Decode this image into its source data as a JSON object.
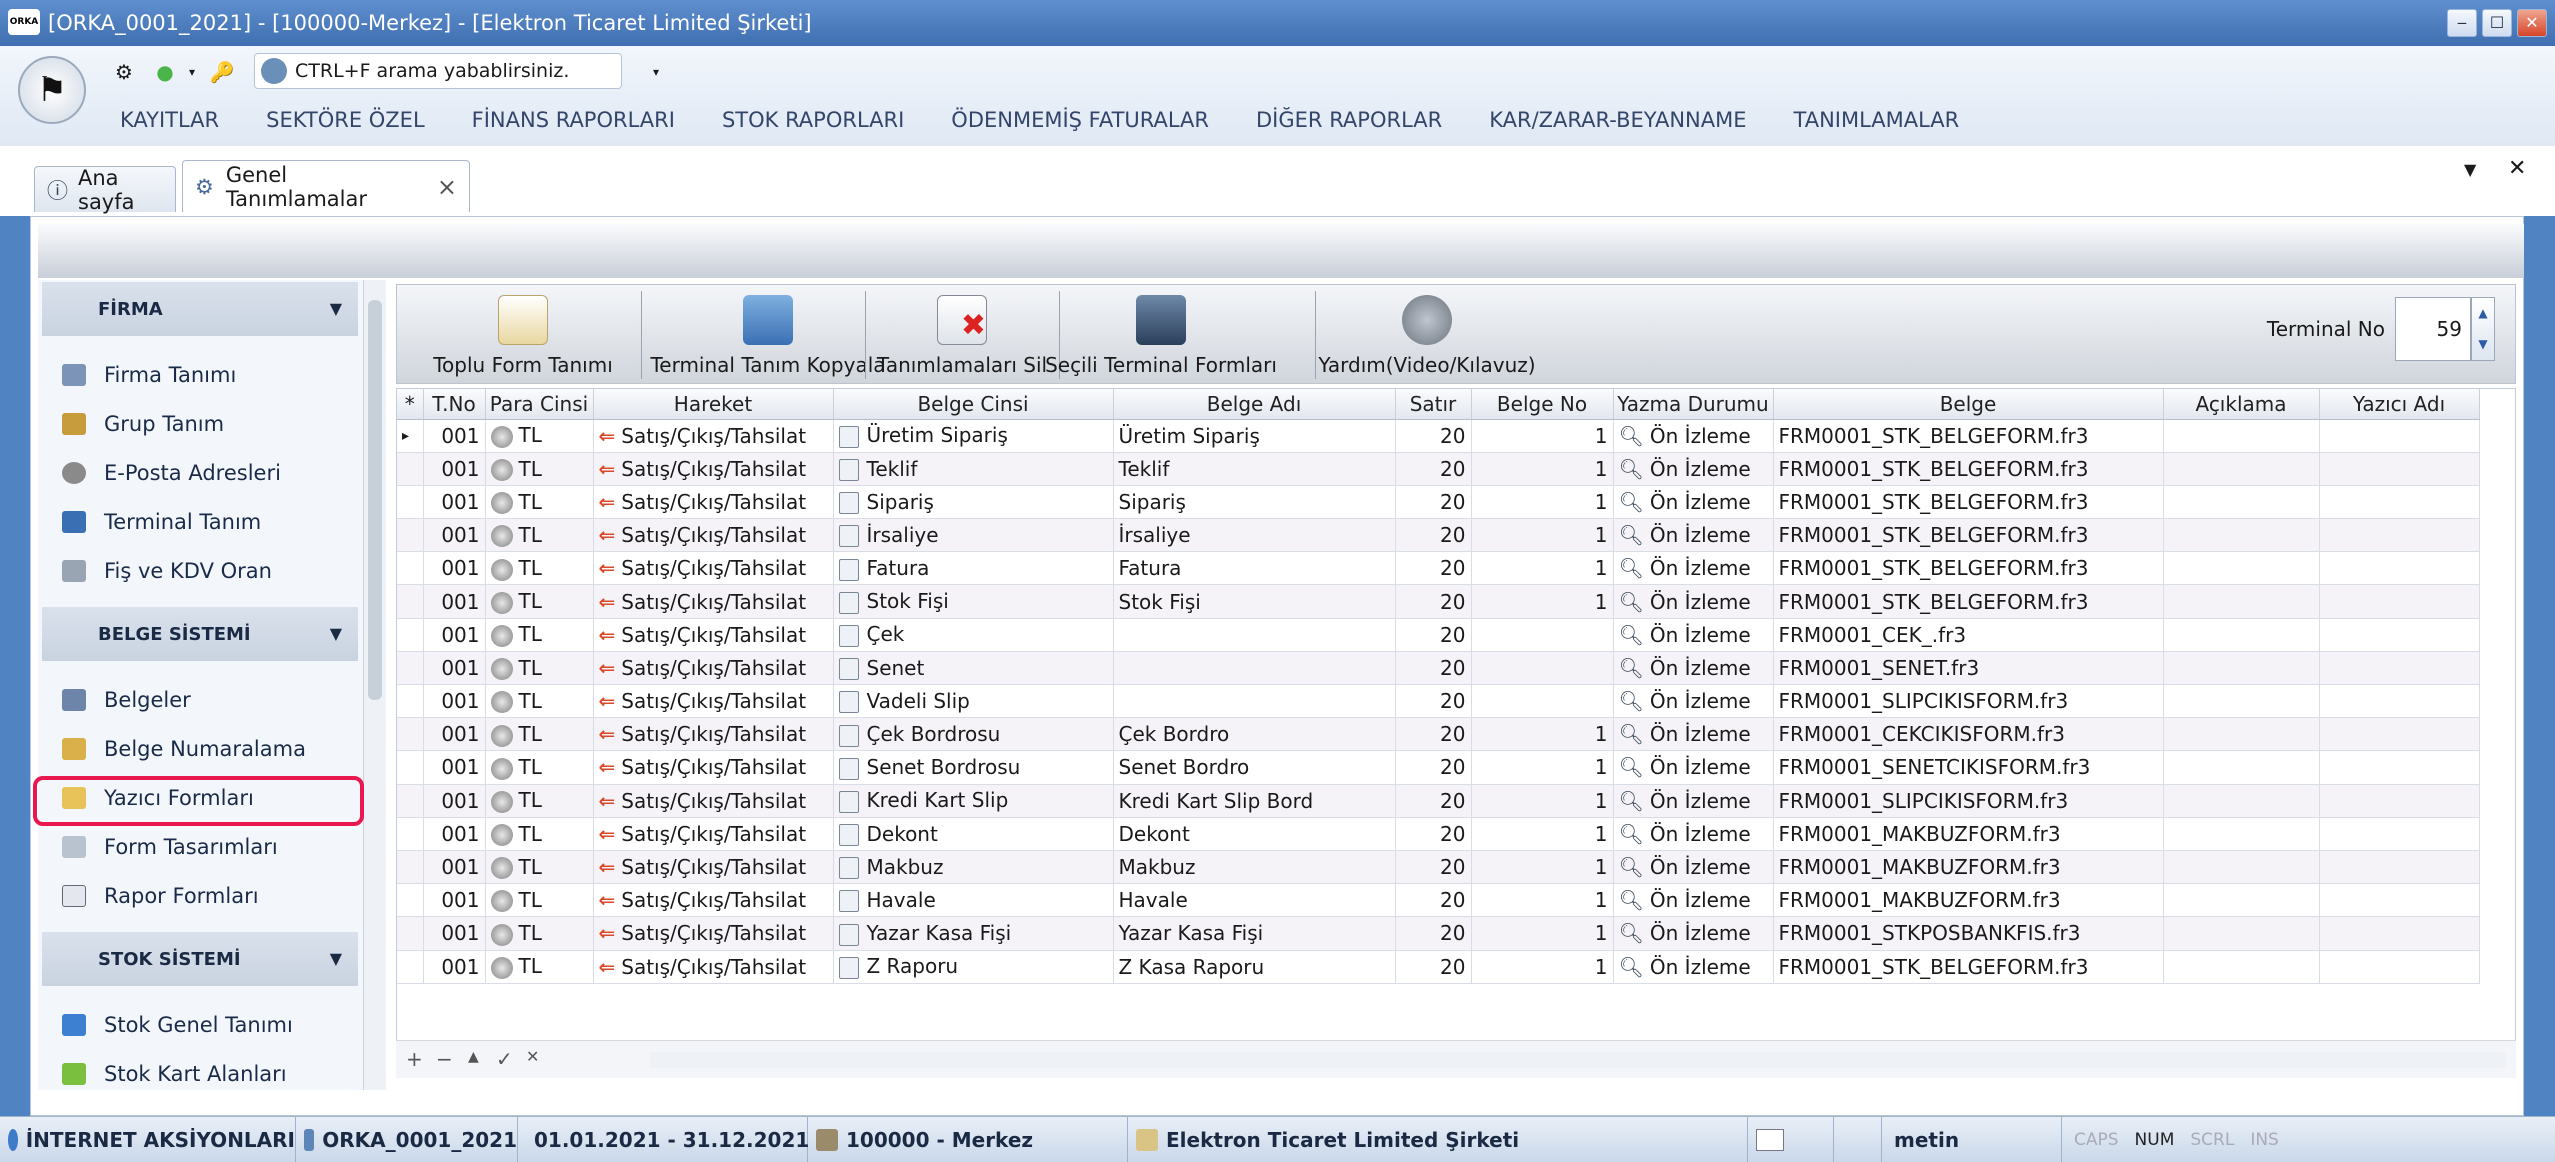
{
  "window": {
    "title": "[ORKA_0001_2021]  -  [100000-Merkez]  -  [Elektron Ticaret Limited Şirketi]",
    "logo": "ORKA"
  },
  "ribbon": {
    "search_placeholder": "CTRL+F arama yabablirsiniz.",
    "menu": [
      "KAYITLAR",
      "SEKTÖRE ÖZEL",
      "FİNANS RAPORLARI",
      "STOK RAPORLARI",
      "ÖDENMEMİŞ FATURALAR",
      "DİĞER RAPORLAR",
      "KAR/ZARAR-BEYANNAME",
      "TANIMLAMALAR"
    ]
  },
  "tabs": [
    {
      "label": "Ana sayfa",
      "icon": "info-icon"
    },
    {
      "label": "Genel Tanımlamalar",
      "icon": "settings-icon",
      "close": "×"
    }
  ],
  "sidebar": {
    "groups": [
      {
        "title": "FİRMA",
        "items": [
          "Firma Tanımı",
          "Grup Tanım",
          "E-Posta Adresleri",
          "Terminal Tanım",
          "Fiş ve KDV Oran"
        ]
      },
      {
        "title": "BELGE SİSTEMİ",
        "items": [
          "Belgeler",
          "Belge Numaralama",
          "Yazıcı Formları",
          "Form Tasarımları",
          "Rapor Formları"
        ]
      },
      {
        "title": "STOK SİSTEMİ",
        "items": [
          "Stok Genel Tanımı",
          "Stok Kart Alanları"
        ]
      }
    ],
    "highlighted_item": "Yazıcı Formları"
  },
  "toolbar": {
    "buttons": [
      "Toplu Form Tanımı",
      "Terminal Tanım Kopyala",
      "Tanımlamaları Sil",
      "Seçili Terminal Formları",
      "Yardım(Video/Kılavuz)"
    ],
    "terminal_label": "Terminal No",
    "terminal_value": "59"
  },
  "grid": {
    "columns": [
      "*",
      "T.No",
      "Para Cinsi",
      "Hareket",
      "Belge Cinsi",
      "Belge Adı",
      "Satır",
      "Belge No",
      "Yazma Durumu",
      "Belge",
      "Açıklama",
      "Yazıcı Adı"
    ],
    "rows": [
      [
        "001",
        "TL",
        "Satış/Çıkış/Tahsilat",
        "Üretim Sipariş",
        "Üretim Sipariş",
        "20",
        "1",
        "Ön İzleme",
        "FRM0001_STK_BELGEFORM.fr3",
        "",
        ""
      ],
      [
        "001",
        "TL",
        "Satış/Çıkış/Tahsilat",
        "Teklif",
        "Teklif",
        "20",
        "1",
        "Ön İzleme",
        "FRM0001_STK_BELGEFORM.fr3",
        "",
        ""
      ],
      [
        "001",
        "TL",
        "Satış/Çıkış/Tahsilat",
        "Sipariş",
        "Sipariş",
        "20",
        "1",
        "Ön İzleme",
        "FRM0001_STK_BELGEFORM.fr3",
        "",
        ""
      ],
      [
        "001",
        "TL",
        "Satış/Çıkış/Tahsilat",
        "İrsaliye",
        "İrsaliye",
        "20",
        "1",
        "Ön İzleme",
        "FRM0001_STK_BELGEFORM.fr3",
        "",
        ""
      ],
      [
        "001",
        "TL",
        "Satış/Çıkış/Tahsilat",
        "Fatura",
        "Fatura",
        "20",
        "1",
        "Ön İzleme",
        "FRM0001_STK_BELGEFORM.fr3",
        "",
        ""
      ],
      [
        "001",
        "TL",
        "Satış/Çıkış/Tahsilat",
        "Stok Fişi",
        "Stok Fişi",
        "20",
        "1",
        "Ön İzleme",
        "FRM0001_STK_BELGEFORM.fr3",
        "",
        ""
      ],
      [
        "001",
        "TL",
        "Satış/Çıkış/Tahsilat",
        "Çek",
        "",
        "20",
        "",
        "Ön İzleme",
        "FRM0001_CEK_.fr3",
        "",
        ""
      ],
      [
        "001",
        "TL",
        "Satış/Çıkış/Tahsilat",
        "Senet",
        "",
        "20",
        "",
        "Ön İzleme",
        "FRM0001_SENET.fr3",
        "",
        ""
      ],
      [
        "001",
        "TL",
        "Satış/Çıkış/Tahsilat",
        "Vadeli Slip",
        "",
        "20",
        "",
        "Ön İzleme",
        "FRM0001_SLIPCIKISFORM.fr3",
        "",
        ""
      ],
      [
        "001",
        "TL",
        "Satış/Çıkış/Tahsilat",
        "Çek Bordrosu",
        "Çek Bordro",
        "20",
        "1",
        "Ön İzleme",
        "FRM0001_CEKCIKISFORM.fr3",
        "",
        ""
      ],
      [
        "001",
        "TL",
        "Satış/Çıkış/Tahsilat",
        "Senet Bordrosu",
        "Senet Bordro",
        "20",
        "1",
        "Ön İzleme",
        "FRM0001_SENETCIKISFORM.fr3",
        "",
        ""
      ],
      [
        "001",
        "TL",
        "Satış/Çıkış/Tahsilat",
        "Kredi Kart Slip",
        "Kredi Kart Slip Bord",
        "20",
        "1",
        "Ön İzleme",
        "FRM0001_SLIPCIKISFORM.fr3",
        "",
        ""
      ],
      [
        "001",
        "TL",
        "Satış/Çıkış/Tahsilat",
        "Dekont",
        "Dekont",
        "20",
        "1",
        "Ön İzleme",
        "FRM0001_MAKBUZFORM.fr3",
        "",
        ""
      ],
      [
        "001",
        "TL",
        "Satış/Çıkış/Tahsilat",
        "Makbuz",
        "Makbuz",
        "20",
        "1",
        "Ön İzleme",
        "FRM0001_MAKBUZFORM.fr3",
        "",
        ""
      ],
      [
        "001",
        "TL",
        "Satış/Çıkış/Tahsilat",
        "Havale",
        "Havale",
        "20",
        "1",
        "Ön İzleme",
        "FRM0001_MAKBUZFORM.fr3",
        "",
        ""
      ],
      [
        "001",
        "TL",
        "Satış/Çıkış/Tahsilat",
        "Yazar Kasa Fişi",
        "Yazar Kasa Fişi",
        "20",
        "1",
        "Ön İzleme",
        "FRM0001_STKPOSBANKFIS.fr3",
        "",
        ""
      ],
      [
        "001",
        "TL",
        "Satış/Çıkış/Tahsilat",
        "Z Raporu",
        "Z Kasa Raporu",
        "20",
        "1",
        "Ön İzleme",
        "FRM0001_STK_BELGEFORM.fr3",
        "",
        ""
      ]
    ],
    "footer_buttons": [
      "+",
      "−",
      "▲",
      "✓",
      "✕"
    ]
  },
  "statusbar": {
    "items": [
      "İNTERNET AKSİYONLARI",
      "ORKA_0001_2021",
      "01.01.2021 - 31.12.2021",
      "100000 - Merkez",
      "Elektron Ticaret Limited Şirketi",
      "",
      "metin"
    ],
    "keys": [
      "CAPS",
      "NUM",
      "SCRL",
      "INS"
    ]
  },
  "colors": {
    "highlight": "#e8174f",
    "titlebar": "#4a7bbd",
    "arrow": "#d94a2a"
  }
}
